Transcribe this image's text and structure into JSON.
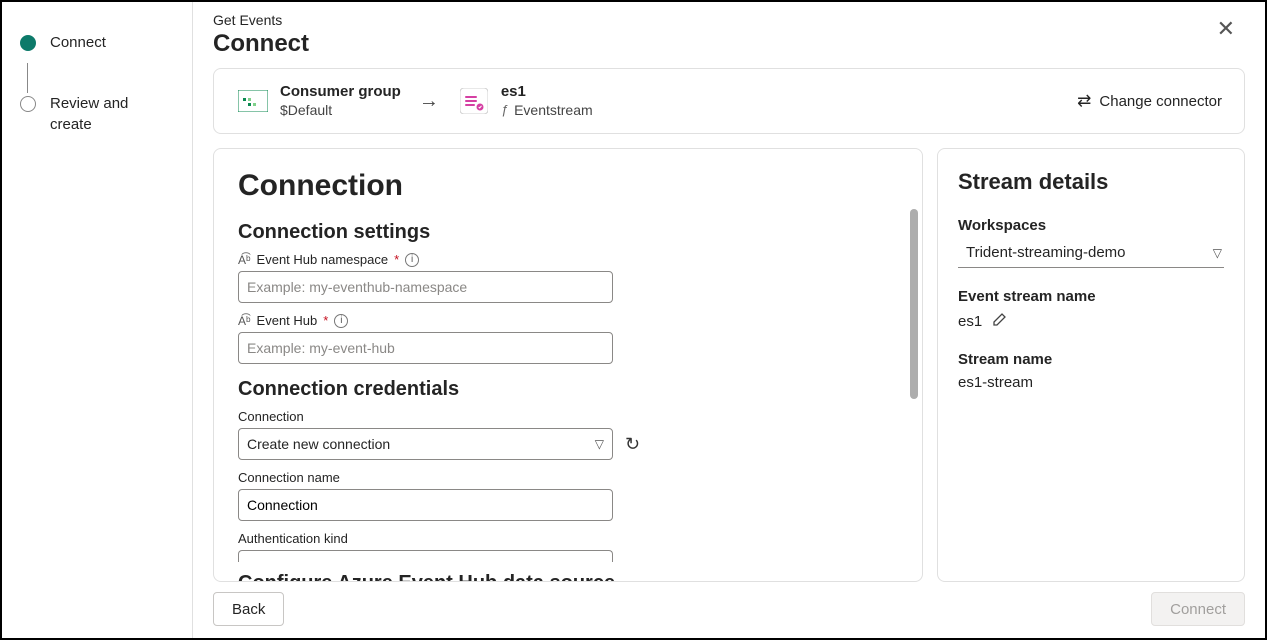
{
  "header": {
    "breadcrumb": "Get Events",
    "title": "Connect"
  },
  "wizard": {
    "steps": [
      {
        "label": "Connect",
        "active": true
      },
      {
        "label": "Review and create",
        "active": false
      }
    ]
  },
  "connector": {
    "source": {
      "title": "Consumer group",
      "subtitle": "$Default"
    },
    "target": {
      "title": "es1",
      "subtitle": "Eventstream"
    },
    "change_label": "Change connector"
  },
  "form": {
    "heading": "Connection",
    "section_settings": "Connection settings",
    "section_credentials": "Connection credentials",
    "section_configure": "Configure Azure Event Hub data source",
    "fields": {
      "eh_namespace": {
        "label": "Event Hub namespace",
        "placeholder": "Example: my-eventhub-namespace",
        "value": ""
      },
      "eh": {
        "label": "Event Hub",
        "placeholder": "Example: my-event-hub",
        "value": ""
      },
      "connection": {
        "label": "Connection",
        "selected": "Create new connection"
      },
      "connection_name": {
        "label": "Connection name",
        "value": "Connection"
      },
      "auth_kind": {
        "label": "Authentication kind"
      }
    }
  },
  "details": {
    "heading": "Stream details",
    "workspace_label": "Workspaces",
    "workspace_value": "Trident-streaming-demo",
    "eventstream_label": "Event stream name",
    "eventstream_value": "es1",
    "streamname_label": "Stream name",
    "streamname_value": "es1-stream"
  },
  "footer": {
    "back": "Back",
    "connect": "Connect"
  }
}
